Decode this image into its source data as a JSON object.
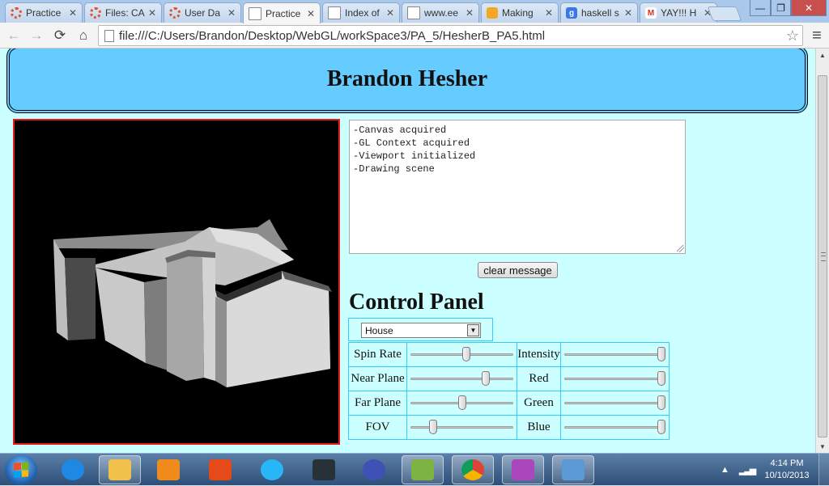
{
  "browser": {
    "tabs": [
      {
        "label": "Practice",
        "icon": "canvas-icon",
        "color": "#e0532a"
      },
      {
        "label": "Files: CA",
        "icon": "canvas-icon",
        "color": "#e0532a"
      },
      {
        "label": "User Da",
        "icon": "canvas-icon",
        "color": "#e0532a"
      },
      {
        "label": "Practice",
        "icon": "page-icon",
        "color": "#ffffff",
        "active": true
      },
      {
        "label": "Index of",
        "icon": "page-icon",
        "color": "#ffffff"
      },
      {
        "label": "www.ee",
        "icon": "page-icon",
        "color": "#ffffff"
      },
      {
        "label": "Making",
        "icon": "face-icon",
        "color": "#f5a623"
      },
      {
        "label": "haskell s",
        "icon": "google-icon",
        "color": "#3b78e7"
      },
      {
        "label": "YAY!!! H",
        "icon": "gmail-icon",
        "color": "#d93025"
      }
    ],
    "window_controls": {
      "minimize": "—",
      "maximize": "❐",
      "close": "✕"
    },
    "nav": {
      "back": "←",
      "forward": "→",
      "reload": "⟳",
      "home": "⌂",
      "star": "☆",
      "menu": "≡"
    },
    "url": "file:///C:/Users/Brandon/Desktop/WebGL/workSpace3/PA_5/HesherB_PA5.html"
  },
  "page": {
    "header_title": "Brandon Hesher",
    "messages": [
      "-Canvas acquired",
      "-GL Context acquired",
      "-Viewport initialized",
      "-Drawing scene"
    ],
    "clear_button": "clear message",
    "control_panel_title": "Control Panel",
    "model_select": {
      "selected": "House"
    },
    "controls": [
      {
        "left_label": "Spin Rate",
        "left_value": 0.55,
        "right_label": "Intensity",
        "right_value": 1.0
      },
      {
        "left_label": "Near Plane",
        "left_value": 0.75,
        "right_label": "Red",
        "right_value": 1.0
      },
      {
        "left_label": "Far Plane",
        "left_value": 0.5,
        "right_label": "Green",
        "right_value": 1.0
      },
      {
        "left_label": "FOV",
        "left_value": 0.2,
        "right_label": "Blue",
        "right_value": 1.0
      }
    ]
  },
  "taskbar": {
    "apps": [
      {
        "name": "internet-explorer-icon",
        "color": "#1e88e5"
      },
      {
        "name": "file-explorer-icon",
        "color": "#f0c24b",
        "open": true
      },
      {
        "name": "media-player-icon",
        "color": "#ef8a1c"
      },
      {
        "name": "paint-net-icon",
        "color": "#e64a19"
      },
      {
        "name": "sync-icon",
        "color": "#29b6f6"
      },
      {
        "name": "console-icon",
        "color": "#263238"
      },
      {
        "name": "eclipse-icon",
        "color": "#3f51b5"
      },
      {
        "name": "editor-icon",
        "color": "#7cb342",
        "open": true
      },
      {
        "name": "chrome-icon",
        "color": "#4caf50",
        "open": true
      },
      {
        "name": "paint-icon",
        "color": "#ab47bc",
        "open": true
      },
      {
        "name": "photo-viewer-icon",
        "color": "#5c9ad6",
        "open": true
      }
    ],
    "time": "4:14 PM",
    "date": "10/10/2013"
  }
}
